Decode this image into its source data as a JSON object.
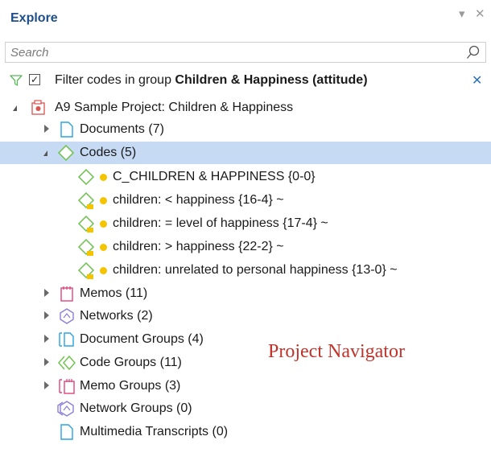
{
  "header": {
    "title": "Explore",
    "dropdown_icon": "chevron-down-icon",
    "close_icon": "close-icon"
  },
  "search": {
    "placeholder": "Search",
    "value": ""
  },
  "filter": {
    "checked": true,
    "prefix": "Filter codes in group ",
    "group": "Children & Happiness (attitude)",
    "close_icon": "close-icon"
  },
  "tree": {
    "project": {
      "label": "A9 Sample Project: Children & Happiness"
    },
    "documents": {
      "label": "Documents (7)"
    },
    "codes": {
      "label": "Codes (5)",
      "items": [
        {
          "label": "C_CHILDREN & HAPPINESS {0-0}"
        },
        {
          "label": "children: < happiness {16-4} ~"
        },
        {
          "label": "children: = level of happiness {17-4} ~"
        },
        {
          "label": "children: > happiness {22-2} ~"
        },
        {
          "label": "children: unrelated to personal happiness {13-0} ~"
        }
      ]
    },
    "memos": {
      "label": "Memos (11)"
    },
    "networks": {
      "label": "Networks (2)"
    },
    "document_groups": {
      "label": "Document Groups (4)"
    },
    "code_groups": {
      "label": "Code Groups (11)"
    },
    "memo_groups": {
      "label": "Memo Groups (3)"
    },
    "network_groups": {
      "label": "Network Groups (0)"
    },
    "multimedia_transcripts": {
      "label": "Multimedia Transcripts (0)"
    }
  },
  "watermark": "Project Navigator",
  "colors": {
    "title": "#1e4e8c",
    "selection": "#c7daf3",
    "code": "#6cc24a",
    "doc": "#29a3e0",
    "memo": "#e0457b",
    "network": "#8a7fd6",
    "dot": "#f5c400"
  }
}
